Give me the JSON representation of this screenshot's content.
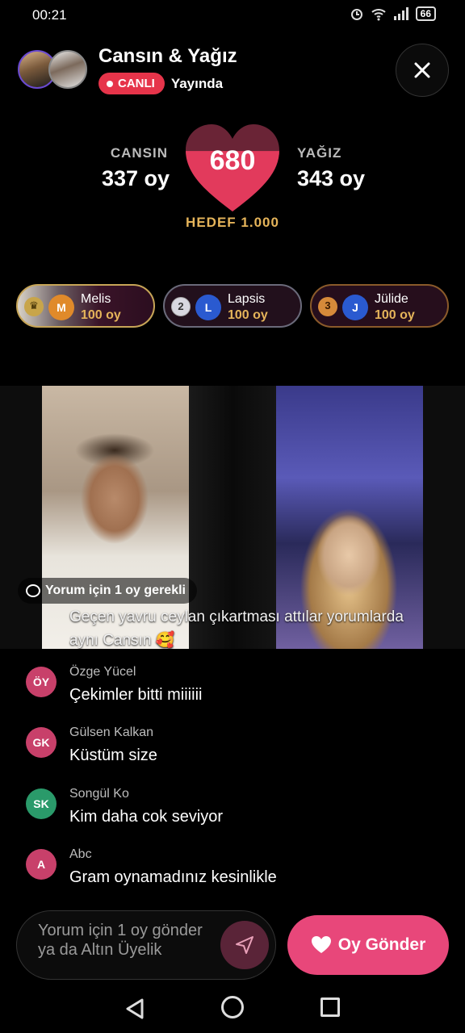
{
  "status": {
    "time": "00:21",
    "battery": "66"
  },
  "header": {
    "title": "Cansın & Yağız",
    "live_label": "CANLI",
    "live_subtitle": "Yayında"
  },
  "score": {
    "left_name": "CANSIN",
    "left_votes": "337 oy",
    "right_name": "YAĞIZ",
    "right_votes": "343 oy",
    "total": "680",
    "progress": 0.68,
    "target": "HEDEF 1.000"
  },
  "ranking": [
    {
      "rank": "1",
      "initial": "M",
      "name": "Melis",
      "votes": "100 oy"
    },
    {
      "rank": "2",
      "initial": "L",
      "name": "Lapsis",
      "votes": "100 oy"
    },
    {
      "rank": "3",
      "initial": "J",
      "name": "Jülide",
      "votes": "100 oy"
    }
  ],
  "video": {
    "comment_hint": "Yorum için 1 oy gerekli",
    "overlay_comment": "Geçen yavru ceylan çıkartması attılar yorumlarda aynı Cansın 🥰"
  },
  "chat": [
    {
      "initials": "ÖY",
      "name": "Özge Yücel",
      "text": "Çekimler bitti miiiiii",
      "color": "#c8406a"
    },
    {
      "initials": "GK",
      "name": "Gülsen Kalkan",
      "text": "Küstüm size",
      "color": "#c8406a"
    },
    {
      "initials": "SK",
      "name": "Songül Ko",
      "text": "Kim daha cok seviyor",
      "color": "#2a9a6a"
    },
    {
      "initials": "A",
      "name": "Abc",
      "text": "Gram oynamadınız kesinlikle",
      "color": "#c8406a"
    }
  ],
  "composer": {
    "placeholder": "Yorum için 1 oy gönder ya da Altın Üyelik",
    "vote_button": "Oy Gönder"
  },
  "colors": {
    "accent": "#e8477a",
    "live": "#e6344a",
    "gold": "#e5b45a"
  }
}
